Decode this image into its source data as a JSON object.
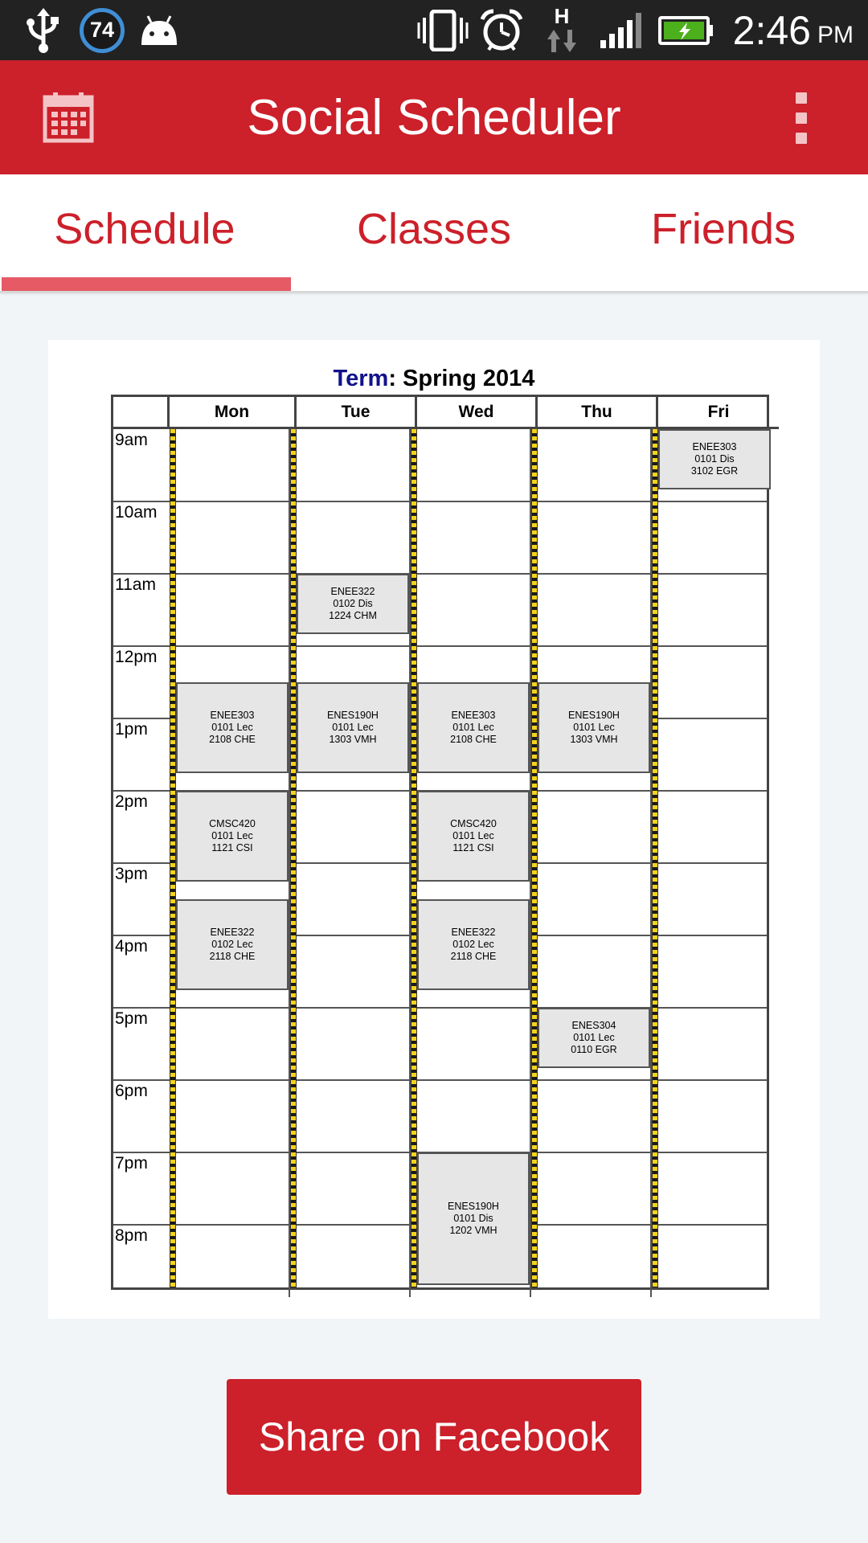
{
  "status_bar": {
    "battery_percent": "74",
    "time": "2:46",
    "ampm": "PM",
    "icons": [
      "usb-icon",
      "battery-circle-icon",
      "android-icon",
      "vibrate-icon",
      "alarm-icon",
      "hsdpa-icon",
      "signal-icon",
      "battery-charging-icon"
    ],
    "network_label": "H"
  },
  "action_bar": {
    "title": "Social Scheduler",
    "color": "#cc202a",
    "icons": [
      "calendar-icon",
      "overflow-menu-icon"
    ]
  },
  "tabs": [
    {
      "label": "Schedule",
      "selected": true
    },
    {
      "label": "Classes",
      "selected": false
    },
    {
      "label": "Friends",
      "selected": false
    }
  ],
  "schedule": {
    "term_label": "Term",
    "term_value": "Spring 2014",
    "days": [
      "Mon",
      "Tue",
      "Wed",
      "Thu",
      "Fri"
    ],
    "times": [
      "9am",
      "10am",
      "11am",
      "12pm",
      "1pm",
      "2pm",
      "3pm",
      "4pm",
      "5pm",
      "6pm",
      "7pm",
      "8pm"
    ],
    "events": [
      {
        "course": "ENEE303",
        "section": "0101 Dis",
        "room": "3102 EGR",
        "day": "Fri",
        "start": "9:00",
        "end": "9:50"
      },
      {
        "course": "ENEE322",
        "section": "0102 Dis",
        "room": "1224 CHM",
        "day": "Tue",
        "start": "11:00",
        "end": "11:50"
      },
      {
        "course": "ENEE303",
        "section": "0101 Lec",
        "room": "2108 CHE",
        "day": "Mon",
        "start": "12:30",
        "end": "13:45"
      },
      {
        "course": "ENES190H",
        "section": "0101 Lec",
        "room": "1303 VMH",
        "day": "Tue",
        "start": "12:30",
        "end": "13:45"
      },
      {
        "course": "ENEE303",
        "section": "0101 Lec",
        "room": "2108 CHE",
        "day": "Wed",
        "start": "12:30",
        "end": "13:45"
      },
      {
        "course": "ENES190H",
        "section": "0101 Lec",
        "room": "1303 VMH",
        "day": "Thu",
        "start": "12:30",
        "end": "13:45"
      },
      {
        "course": "CMSC420",
        "section": "0101 Lec",
        "room": "1121 CSI",
        "day": "Mon",
        "start": "14:00",
        "end": "15:15"
      },
      {
        "course": "CMSC420",
        "section": "0101 Lec",
        "room": "1121 CSI",
        "day": "Wed",
        "start": "14:00",
        "end": "15:15"
      },
      {
        "course": "ENEE322",
        "section": "0102 Lec",
        "room": "2118 CHE",
        "day": "Mon",
        "start": "15:30",
        "end": "16:45"
      },
      {
        "course": "ENEE322",
        "section": "0102 Lec",
        "room": "2118 CHE",
        "day": "Wed",
        "start": "15:30",
        "end": "16:45"
      },
      {
        "course": "ENES304",
        "section": "0101 Lec",
        "room": "0110 EGR",
        "day": "Thu",
        "start": "17:00",
        "end": "17:50"
      },
      {
        "course": "ENES190H",
        "section": "0101 Dis",
        "room": "1202 VMH",
        "day": "Wed",
        "start": "19:00",
        "end": "20:50"
      }
    ]
  },
  "share_button_label": "Share on Facebook"
}
